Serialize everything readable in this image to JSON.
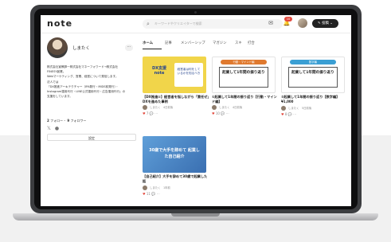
{
  "header": {
    "logo": "note",
    "search_placeholder": "キーワードやクリエイターで検索",
    "search_icon": "search-icon",
    "notifications_count": "10",
    "post_button": "✎ 投稿 ⌄"
  },
  "profile": {
    "name": "しまたく",
    "more": "⋯",
    "bio": [
      "株式会社宣教師一株式会社マネーフォワード→株式会社",
      "FINESY創業。",
      "Webマーケティング、営業、経営について発信します。",
      "法人では",
      "『DX推進アーキテクチャー（IPA発行・MIDS前発行）・",
      "Instagram運用代行・LINE公式運用代行・広告運用代行』の",
      "支援をしています。"
    ],
    "follow_count": "2",
    "follow_label": "フォロー・",
    "follower_count": "9",
    "follower_label": "フォロワー",
    "follow_button": "設定"
  },
  "tabs": [
    {
      "label": "ホーム"
    },
    {
      "label": "記事"
    },
    {
      "label": "メンバーシップ"
    },
    {
      "label": "マガジン"
    },
    {
      "label": "スキ"
    },
    {
      "label": "打合"
    }
  ],
  "articles": [
    {
      "thumb_lines": [
        "DX支援",
        "note"
      ],
      "thumb_side": "経営者は何をしているかを知るべき",
      "title": "【DX推進①】経営者を悩しながら「責任ぜ」DXを進めた事例",
      "author": "しまたく　4日前後",
      "likes": "7",
      "meta": "💬 ⋯"
    },
    {
      "tag": "行動・マインド編",
      "tag_color": "#e07a2f",
      "thumb_box": "起業して1年間の振り返り",
      "title": "①起業して1年間の振り返り【行動・マインド編】",
      "author": "しまたく　4日前後",
      "likes": "10",
      "meta": "💬 ⋯"
    },
    {
      "tag": "数字編",
      "tag_color": "#3a9fd4",
      "thumb_box": "起業して1年間の振り返り",
      "title": "②起業して1年間の振り返り【数字編】",
      "price": "¥1,000",
      "author": "しまたく　5日前後",
      "likes": "8",
      "meta": "💬 ⋯"
    },
    {
      "thumb_text": "30歳で大手を辞めて 起業した自己紹介",
      "title": "【自己紹介】大手を辞めて30歳で起業した話",
      "author": "しまたく　1年前",
      "likes": "11",
      "meta": "💬 ⋯"
    }
  ],
  "colors": {
    "yellow_thumb": "#f1d54a",
    "navy_text": "#23428d",
    "blue_thumb": "#3a6fb1",
    "heart": "#e2483d"
  }
}
